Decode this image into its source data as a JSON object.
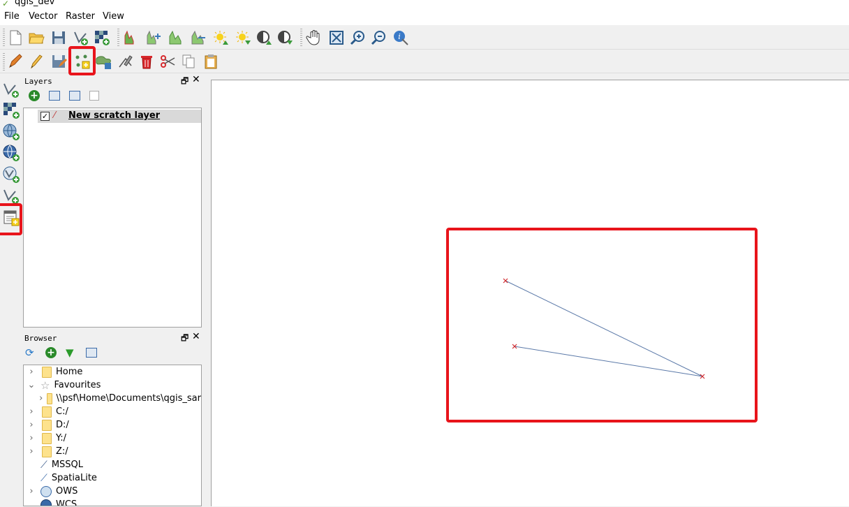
{
  "window": {
    "title": "qgis_dev"
  },
  "menu": {
    "items": [
      "File",
      "Vector",
      "Raster",
      "View"
    ]
  },
  "layers_panel": {
    "title": "Layers",
    "layer": {
      "name": "New scratch layer",
      "checked": true
    }
  },
  "browser_panel": {
    "title": "Browser",
    "items": [
      {
        "label": "Home",
        "expander": "›"
      },
      {
        "label": "Favourites",
        "expander": "⌄"
      },
      {
        "label": "\\\\psf\\Home\\Documents\\qgis_sar",
        "expander": "›"
      },
      {
        "label": "C:/",
        "expander": "›"
      },
      {
        "label": "D:/",
        "expander": "›"
      },
      {
        "label": "Y:/",
        "expander": "›"
      },
      {
        "label": "Z:/",
        "expander": "›"
      },
      {
        "label": "MSSQL",
        "expander": ""
      },
      {
        "label": "SpatiaLite",
        "expander": ""
      },
      {
        "label": "OWS",
        "expander": "›"
      },
      {
        "label": "WCS",
        "expander": ""
      }
    ]
  },
  "colors": {
    "highlight": "#e8141b",
    "line": "#5b79a8",
    "marker": "#d0282c"
  }
}
